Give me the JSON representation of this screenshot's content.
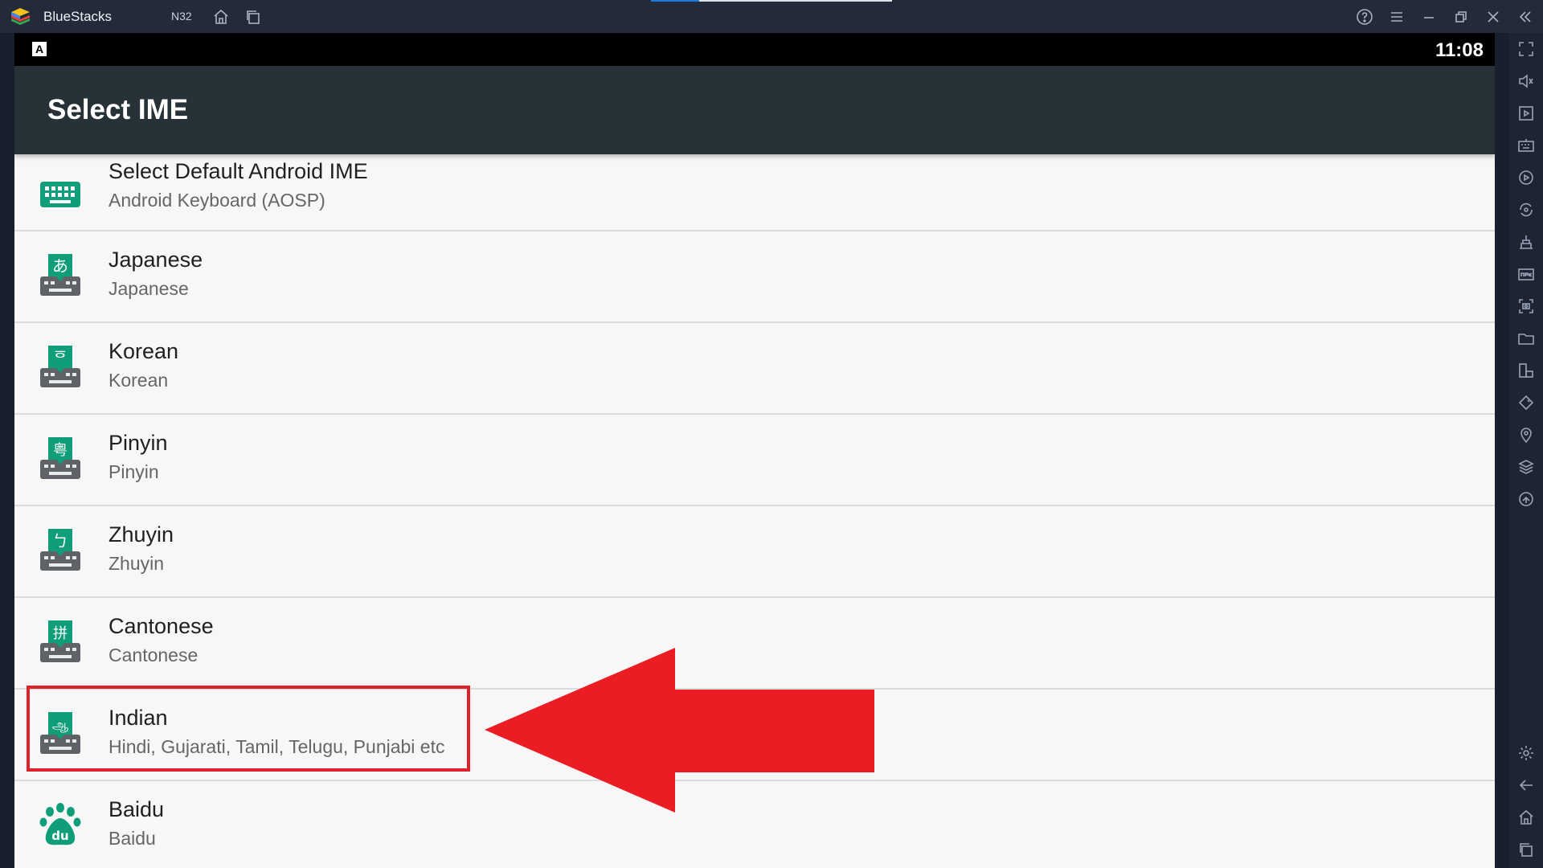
{
  "window": {
    "app_title": "BlueStacks",
    "instance_label": "N32",
    "accent_color": "#1f7ae0"
  },
  "titlebar_icons": [
    "home-icon",
    "multi-instance-icon",
    "help-icon",
    "menu-icon",
    "minimize-icon",
    "restore-icon",
    "close-icon",
    "collapse-sidebar-icon"
  ],
  "android": {
    "status": {
      "indicator": "A",
      "time": "11:08"
    },
    "appbar_title": "Select IME",
    "items": [
      {
        "title": "Select Default Android IME",
        "subtitle": "Android Keyboard (AOSP)",
        "icon": "keyboard-icon",
        "glyph": ""
      },
      {
        "title": "Japanese",
        "subtitle": "Japanese",
        "icon": "japanese-ime-icon",
        "glyph": "あ"
      },
      {
        "title": "Korean",
        "subtitle": "Korean",
        "icon": "korean-ime-icon",
        "glyph": "ᅙ"
      },
      {
        "title": "Pinyin",
        "subtitle": "Pinyin",
        "icon": "pinyin-ime-icon",
        "glyph": "粤"
      },
      {
        "title": "Zhuyin",
        "subtitle": "Zhuyin",
        "icon": "zhuyin-ime-icon",
        "glyph": "ㄅ"
      },
      {
        "title": "Cantonese",
        "subtitle": "Cantonese",
        "icon": "cantonese-ime-icon",
        "glyph": "拼"
      },
      {
        "title": "Indian",
        "subtitle": "Hindi, Gujarati, Tamil, Telugu, Punjabi etc",
        "icon": "indian-ime-icon",
        "glyph": "ஆ"
      },
      {
        "title": "Baidu",
        "subtitle": "Baidu",
        "icon": "baidu-paw-icon",
        "glyph": "du"
      }
    ],
    "icon_color": "#0f9d7a",
    "keyboard_base_color": "#5f6368"
  },
  "annotation": {
    "highlight_color": "#e0202a",
    "arrow_color": "#ec1c24",
    "highlighted_item": "Indian"
  },
  "sidebar_icons": [
    "fullscreen-icon",
    "volume-icon",
    "screen-record-icon",
    "keyboard-controls-icon",
    "macro-icon",
    "sync-icon",
    "install-apk-icon",
    "apk-icon",
    "screenshot-icon",
    "folder-icon",
    "multi-window-icon",
    "rotate-icon",
    "location-icon",
    "layers-icon",
    "eco-mode-icon",
    "settings-icon",
    "back-icon",
    "home-icon",
    "recent-apps-icon"
  ]
}
